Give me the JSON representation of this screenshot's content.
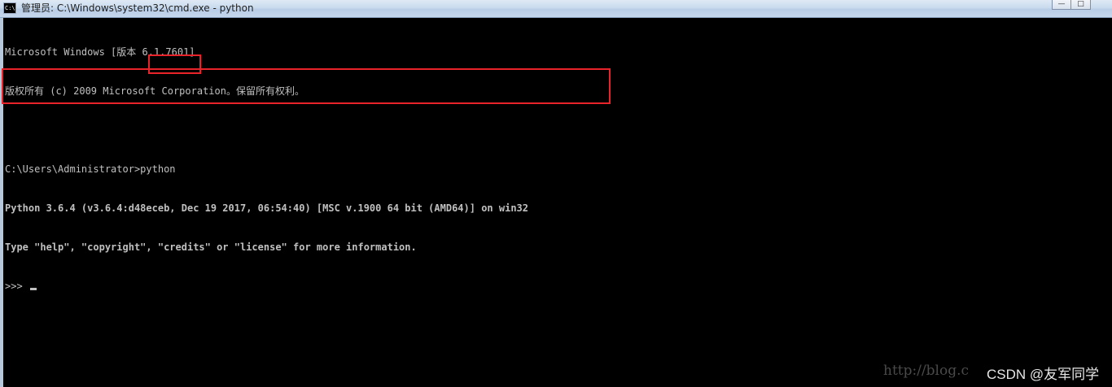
{
  "window": {
    "title": "管理员: C:\\Windows\\system32\\cmd.exe - python",
    "icon": "cmd-icon",
    "icon_text": "C:\\",
    "buttons": {
      "minimize_icon": "minimize-icon",
      "minimize_label": "—",
      "maximize_icon": "maximize-icon",
      "maximize_label": "□"
    }
  },
  "console": {
    "lines": [
      "Microsoft Windows [版本 6.1.7601]",
      "版权所有 (c) 2009 Microsoft Corporation。保留所有权利。",
      "",
      "C:\\Users\\Administrator>python",
      "Python 3.6.4 (v3.6.4:d48eceb, Dec 19 2017, 06:54:40) [MSC v.1900 64 bit (AMD64)] on win32",
      "Type \"help\", \"copyright\", \"credits\" or \"license\" for more information.",
      ">>> "
    ],
    "text_color": "#c0c0c0",
    "background": "#000000"
  },
  "annotations": {
    "highlight_color": "#e8242a"
  },
  "watermark": {
    "url": "http://blog.c",
    "author": "CSDN @友军同学"
  }
}
